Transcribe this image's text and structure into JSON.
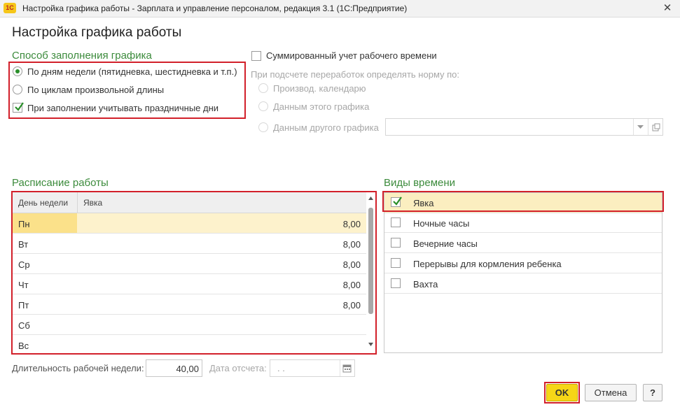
{
  "window": {
    "app_icon": "1С",
    "title": "Настройка графика работы - Зарплата и управление персоналом, редакция 3.1  (1С:Предприятие)",
    "close_glyph": "✕"
  },
  "page_title": "Настройка графика работы",
  "fill_method": {
    "title": "Способ заполнения графика",
    "options": [
      {
        "label": "По дням недели (пятидневка, шестидневка и т.п.)",
        "selected": true
      },
      {
        "label": "По циклам произвольной длины",
        "selected": false
      }
    ],
    "holidays_checkbox": {
      "label": "При заполнении учитывать праздничные дни",
      "checked": true
    }
  },
  "summary": {
    "checkbox_label": "Суммированный учет рабочего времени",
    "norm_caption": "При подсчете переработок определять норму по:",
    "options": [
      {
        "label": "Производ. календарю"
      },
      {
        "label": "Данным этого графика"
      },
      {
        "label": "Данным другого графика"
      }
    ],
    "other_schedule_value": ""
  },
  "schedule": {
    "title": "Расписание работы",
    "columns": [
      "День недели",
      "Явка"
    ],
    "rows": [
      {
        "day": "Пн",
        "value": "8,00"
      },
      {
        "day": "Вт",
        "value": "8,00"
      },
      {
        "day": "Ср",
        "value": "8,00"
      },
      {
        "day": "Чт",
        "value": "8,00"
      },
      {
        "day": "Пт",
        "value": "8,00"
      },
      {
        "day": "Сб",
        "value": ""
      },
      {
        "day": "Вс",
        "value": ""
      }
    ]
  },
  "time_types": {
    "title": "Виды времени",
    "items": [
      {
        "label": "Явка",
        "checked": true
      },
      {
        "label": "Ночные часы",
        "checked": false
      },
      {
        "label": "Вечерние часы",
        "checked": false
      },
      {
        "label": "Перерывы для кормления ребенка",
        "checked": false
      },
      {
        "label": "Вахта",
        "checked": false
      }
    ]
  },
  "week_length": {
    "label": "Длительность рабочей недели:",
    "value": "40,00"
  },
  "ref_date": {
    "label": "Дата отсчета:",
    "value": ".   ."
  },
  "buttons": {
    "ok": "OK",
    "cancel": "Отмена",
    "help": "?"
  },
  "colors": {
    "accent_green": "#3c8b3c",
    "highlight": "#d2202a",
    "selected_row": "#fbeec0",
    "ok_button": "#f6d617"
  }
}
